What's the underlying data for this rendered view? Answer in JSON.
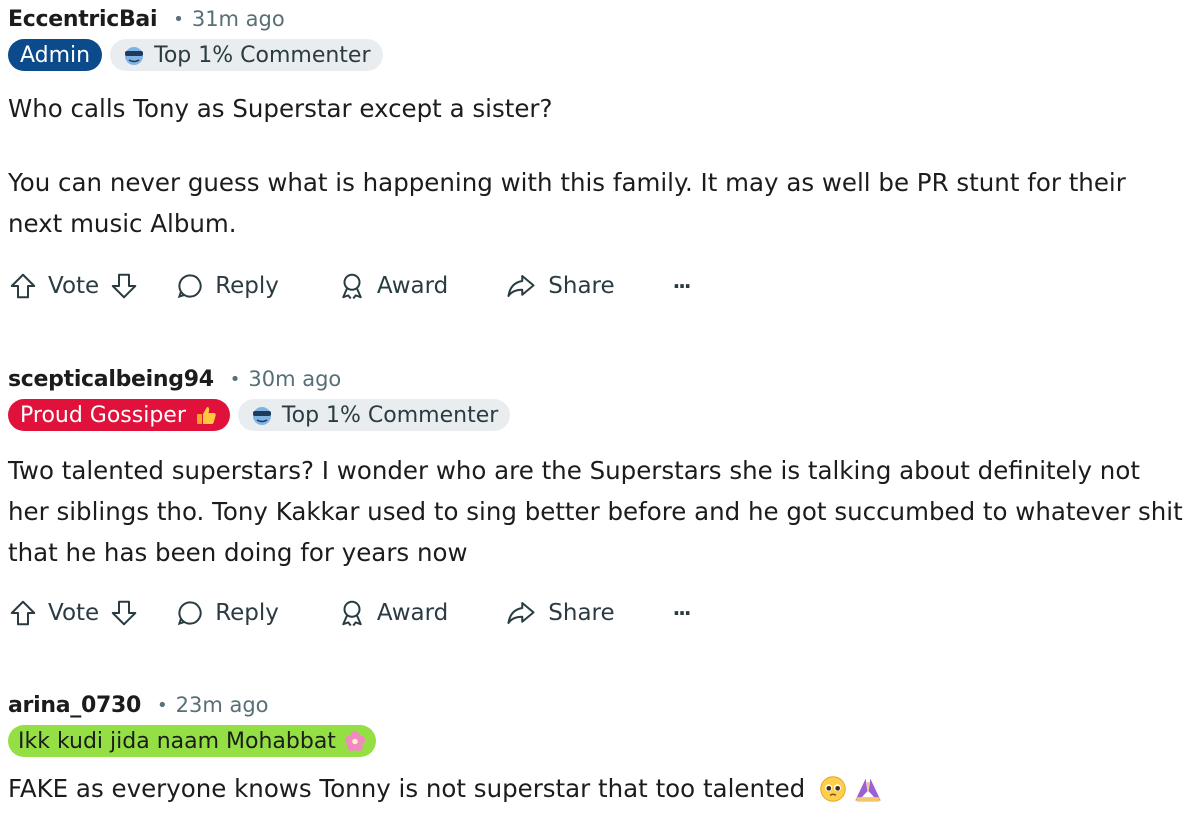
{
  "comments": [
    {
      "author": "EccentricBai",
      "separator": "•",
      "time": "31m ago",
      "flair": "Admin",
      "badge": "Top 1% Commenter",
      "body": [
        "Who calls Tony as Superstar except a sister?",
        "You can never guess what is happening with this family. It may as well be PR stunt for their next music Album."
      ]
    },
    {
      "author": "scepticalbeing94",
      "separator": "•",
      "time": "30m ago",
      "flair": "Proud Gossiper",
      "badge": "Top 1% Commenter",
      "body": [
        "Two talented superstars? I wonder who are the Superstars she is talking about definitely not her siblings tho. Tony Kakkar used to sing better before and he got succumbed to whatever shit that he has been doing for years now"
      ]
    },
    {
      "author": "arina_0730",
      "separator": "•",
      "time": "23m ago",
      "flair": "Ikk kudi jida naam Mohabbat",
      "body": [
        "FAKE as everyone knows Tonny is not superstar that too talented"
      ]
    }
  ],
  "actions": {
    "vote": "Vote",
    "reply": "Reply",
    "award": "Award",
    "share": "Share",
    "more": "···"
  },
  "colors": {
    "admin_flair": "#0b4a8b",
    "gossiper_flair": "#e0123c",
    "green_flair": "#94e044",
    "badge_bg": "#eaedef",
    "meta_text": "#576f76"
  },
  "icons": [
    "upvote-icon",
    "downvote-icon",
    "reply-icon",
    "award-icon",
    "share-icon",
    "more-icon",
    "commenter-badge-icon",
    "thumbs-up-emoji",
    "flower-emoji",
    "pleading-face-emoji",
    "praying-hands-emoji"
  ]
}
